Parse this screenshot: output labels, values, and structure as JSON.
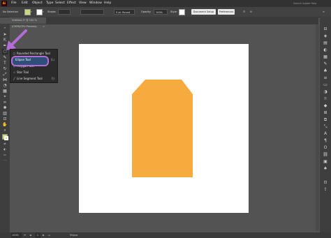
{
  "menubar": {
    "app_logo": "Ai",
    "items": [
      "File",
      "Edit",
      "Object",
      "Type",
      "Select",
      "Effect",
      "View",
      "Window",
      "Help"
    ],
    "search_placeholder": "Search Adobe Help"
  },
  "control_bar": {
    "selection_label": "No Selection",
    "stroke_label": "Stroke:",
    "stroke_profile": "5 pt. Round",
    "opacity_label": "Opacity:",
    "opacity_value": "100%",
    "style_label": "Style:",
    "document_setup_label": "Document Setup",
    "preferences_label": "Preferences",
    "fill_color": "#c8d87a",
    "stroke_color": "#ffffff"
  },
  "document": {
    "tab_title": "Untitled-1* @ 100 % (CMYK/CPU Preview)",
    "tab_close": "×"
  },
  "flyout": {
    "items": [
      {
        "label": "Rounded Rectangle Tool",
        "icon": "rounded-rect-icon",
        "glyph": "▢",
        "key": ""
      },
      {
        "label": "Ellipse Tool",
        "icon": "ellipse-icon",
        "glyph": "○",
        "key": "(L)"
      },
      {
        "label": "Polygon Tool",
        "icon": "polygon-icon",
        "glyph": "⬡",
        "key": ""
      },
      {
        "label": "Star Tool",
        "icon": "star-icon",
        "glyph": "☆",
        "key": ""
      },
      {
        "label": "Line Segment Tool",
        "icon": "line-icon",
        "glyph": "╱",
        "key": "(\\)"
      }
    ]
  },
  "canvas": {
    "shape_color": "#f7ab3e",
    "artboard_color": "#ffffff"
  },
  "status_bar": {
    "zoom": "100%",
    "artboard_nav": "1",
    "tool_status": "Ellipse"
  },
  "annotation": {
    "arrow_color": "#b56dd6"
  }
}
